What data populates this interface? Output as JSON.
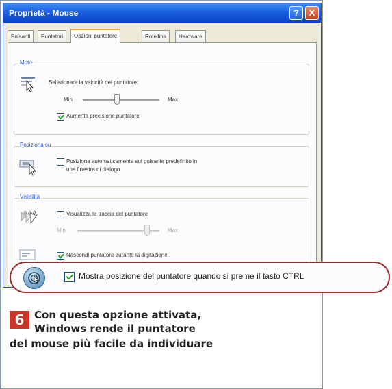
{
  "window": {
    "title": "Proprietà - Mouse",
    "help_glyph": "?",
    "close_glyph": "X"
  },
  "tabs": [
    {
      "label": "Pulsanti",
      "active": false
    },
    {
      "label": "Puntatori",
      "active": false
    },
    {
      "label": "Opzioni puntatore",
      "active": true
    },
    {
      "label": "Rotellina",
      "active": false
    },
    {
      "label": "Hardware",
      "active": false
    }
  ],
  "motion": {
    "group_label": "Moto",
    "speed_label": "Selezionare la velocità del puntatore:",
    "min_label": "Min",
    "max_label": "Max",
    "speed_level": 0.45,
    "precision_label": "Aumenta precisione puntatore",
    "precision_checked": true
  },
  "snap_to": {
    "group_label": "Posiziona su",
    "label_line1": "Posiziona automaticamente sul pulsante predefinito in",
    "label_line2": "una finestra di dialogo",
    "checked": false
  },
  "visibility": {
    "group_label": "Visibilità",
    "trails_label": "Visualizza la traccia del puntatore",
    "trails_checked": false,
    "trails_min_label": "Min",
    "trails_max_label": "Max",
    "trails_level": 0.85,
    "hide_typing_label": "Nascondi puntatore durante la digitazione",
    "hide_typing_checked": true,
    "show_location_label": "Mostra posizione del puntatore quando si preme il tasto CTRL",
    "show_location_checked": true
  },
  "caption": {
    "number": "6",
    "line1": "Con questa opzione attivata,",
    "line2": "Windows rende il puntatore",
    "line3": "del mouse più facile da individuare"
  },
  "colors": {
    "accent_red": "#c8372b",
    "highlight_border": "#9c2a28",
    "xp_title_blue": "#0a44c8"
  }
}
